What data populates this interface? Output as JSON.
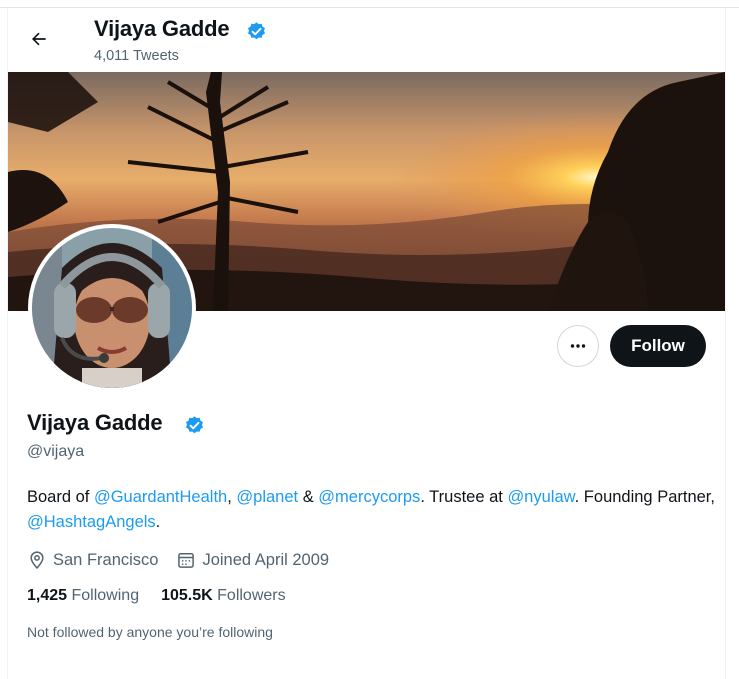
{
  "header": {
    "name": "Vijaya Gadde",
    "tweet_count": "4,011 Tweets"
  },
  "profile": {
    "name": "Vijaya Gadde",
    "handle": "@vijaya",
    "verified": true,
    "bio": {
      "t1": "Board of ",
      "m1": "@GuardantHealth",
      "t2": ", ",
      "m2": "@planet",
      "t3": " & ",
      "m3": "@mercycorps",
      "t4": ". Trustee at ",
      "m4": "@nyulaw",
      "t5": ". Founding Partner, ",
      "m5": "@HashtagAngels",
      "t6": "."
    },
    "location": "San Francisco",
    "joined": "Joined April 2009",
    "following_count": "1,425",
    "following_label": "Following",
    "followers_count": "105.5K",
    "followers_label": "Followers",
    "mutual_text": "Not followed by anyone you’re following"
  },
  "actions": {
    "follow_label": "Follow",
    "more_icon": "more-horizontal-icon"
  },
  "colors": {
    "accent": "#1d9bf0",
    "text_primary": "#0f1419",
    "text_secondary": "#536471",
    "follow_bg": "#0f1419"
  }
}
